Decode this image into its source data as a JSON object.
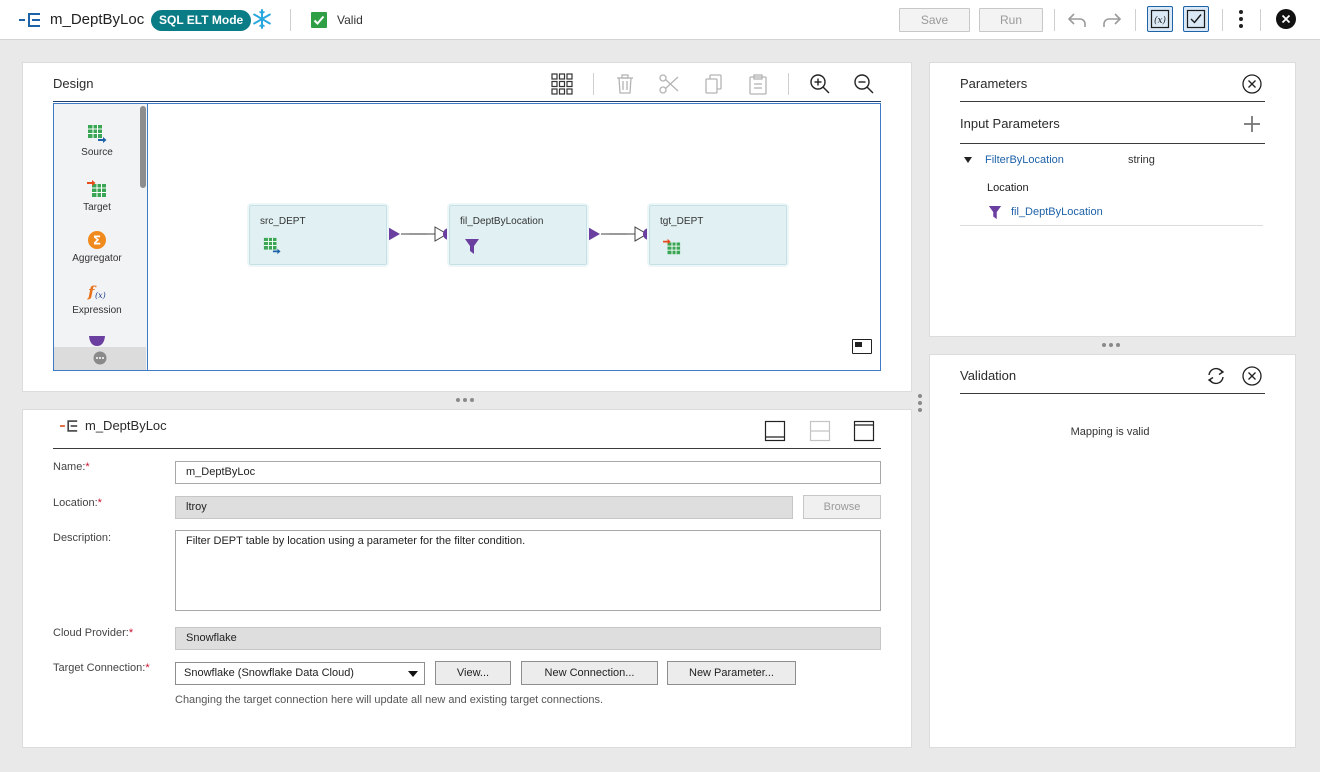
{
  "topbar": {
    "title": "m_DeptByLoc",
    "mode_badge": "SQL ELT Mode",
    "status": "Valid",
    "save_label": "Save",
    "run_label": "Run"
  },
  "design": {
    "title": "Design",
    "palette": [
      {
        "label": "Source",
        "icon": "source-icon"
      },
      {
        "label": "Target",
        "icon": "target-icon"
      },
      {
        "label": "Aggregator",
        "icon": "aggregator-icon"
      },
      {
        "label": "Expression",
        "icon": "expression-icon"
      }
    ],
    "nodes": [
      {
        "label": "src_DEPT",
        "icon": "source-icon"
      },
      {
        "label": "fil_DeptByLocation",
        "icon": "filter-icon"
      },
      {
        "label": "tgt_DEPT",
        "icon": "target-icon"
      }
    ]
  },
  "properties": {
    "title": "m_DeptByLoc",
    "name_label": "Name:",
    "name_value": "m_DeptByLoc",
    "location_label": "Location:",
    "location_value": "ltroy",
    "browse_label": "Browse",
    "description_label": "Description:",
    "description_value": "Filter DEPT table by location using a parameter for the filter condition.",
    "cloud_label": "Cloud Provider:",
    "cloud_value": "Snowflake",
    "target_label": "Target Connection:",
    "target_value": "Snowflake (Snowflake Data Cloud)",
    "view_label": "View...",
    "new_connection_label": "New Connection...",
    "new_parameter_label": "New Parameter...",
    "hint": "Changing the target connection here will update all new and existing target connections."
  },
  "parameters": {
    "title": "Parameters",
    "input_title": "Input Parameters",
    "param_name": "FilterByLocation",
    "param_type": "string",
    "group_label": "Location",
    "usage": "fil_DeptByLocation"
  },
  "validation": {
    "title": "Validation",
    "message": "Mapping is valid"
  },
  "colors": {
    "accent": "#1e62a8",
    "badge": "#0a7c86",
    "valid": "#2f9f45",
    "filter": "#6b3fa0",
    "node_fill": "#e1f1f3"
  }
}
